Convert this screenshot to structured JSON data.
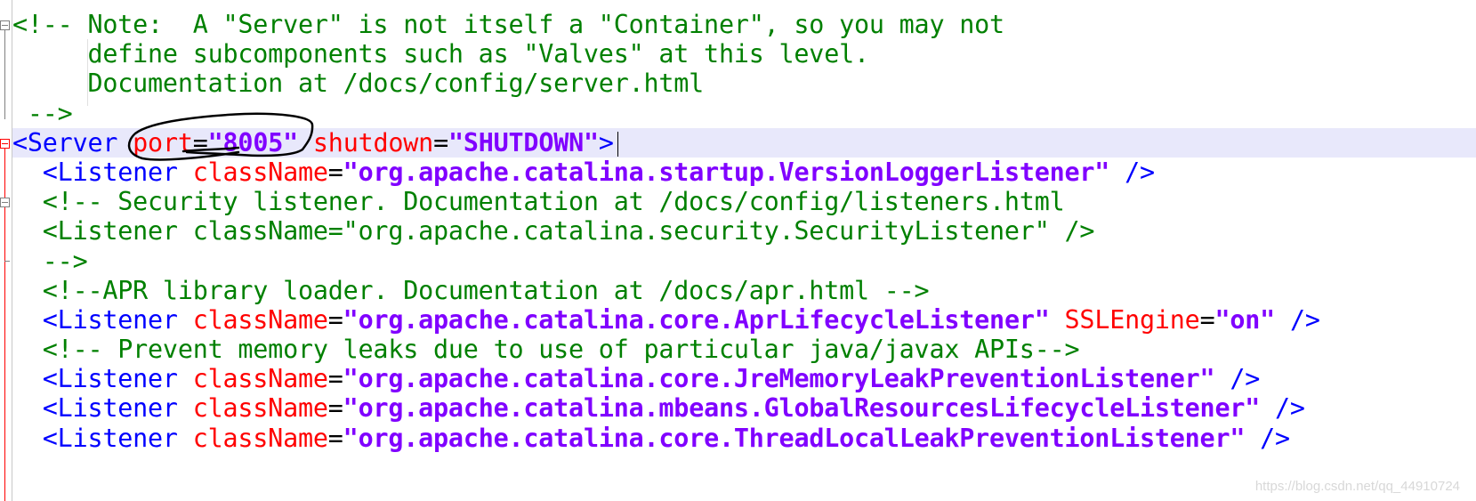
{
  "colors": {
    "comment": "#008000",
    "tag": "#0000ff",
    "attribute": "#ff0000",
    "value": "#8000ff",
    "current_line_bg": "#e8e8fb",
    "fold_marker": "#ff0000",
    "annotation_ink": "#000000"
  },
  "current_line": 4,
  "lines": [
    [
      [
        "comment",
        "<!-- Note:  A \"Server\" is not itself a \"Container\", so you may not"
      ]
    ],
    [
      [
        "comment",
        "     define subcomponents such as \"Valves\" at this level."
      ]
    ],
    [
      [
        "comment",
        "     Documentation at /docs/config/server.html"
      ]
    ],
    [
      [
        "comment",
        " -->"
      ]
    ],
    [
      [
        "tag",
        "<Server "
      ],
      [
        "attr",
        "port"
      ],
      [
        "eq",
        "="
      ],
      [
        "value",
        "\"8005\""
      ],
      [
        "text",
        " "
      ],
      [
        "attr",
        "shutdown"
      ],
      [
        "eq",
        "="
      ],
      [
        "value",
        "\"SHUTDOWN\""
      ],
      [
        "tag",
        ">"
      ]
    ],
    [
      [
        "tag",
        "  <Listener "
      ],
      [
        "attr",
        "className"
      ],
      [
        "eq",
        "="
      ],
      [
        "value",
        "\"org.apache.catalina.startup.VersionLoggerListener\""
      ],
      [
        "tag",
        " />"
      ]
    ],
    [
      [
        "comment",
        "  <!-- Security listener. Documentation at /docs/config/listeners.html"
      ]
    ],
    [
      [
        "comment",
        "  <Listener className=\"org.apache.catalina.security.SecurityListener\" />"
      ]
    ],
    [
      [
        "comment",
        "  -->"
      ]
    ],
    [
      [
        "comment",
        "  <!--APR library loader. Documentation at /docs/apr.html -->"
      ]
    ],
    [
      [
        "tag",
        "  <Listener "
      ],
      [
        "attr",
        "className"
      ],
      [
        "eq",
        "="
      ],
      [
        "value",
        "\"org.apache.catalina.core.AprLifecycleListener\""
      ],
      [
        "text",
        " "
      ],
      [
        "attr",
        "SSLEngine"
      ],
      [
        "eq",
        "="
      ],
      [
        "value",
        "\"on\""
      ],
      [
        "tag",
        " />"
      ]
    ],
    [
      [
        "comment",
        "  <!-- Prevent memory leaks due to use of particular java/javax APIs-->"
      ]
    ],
    [
      [
        "tag",
        "  <Listener "
      ],
      [
        "attr",
        "className"
      ],
      [
        "eq",
        "="
      ],
      [
        "value",
        "\"org.apache.catalina.core.JreMemoryLeakPreventionListener\""
      ],
      [
        "tag",
        " />"
      ]
    ],
    [
      [
        "tag",
        "  <Listener "
      ],
      [
        "attr",
        "className"
      ],
      [
        "eq",
        "="
      ],
      [
        "value",
        "\"org.apache.catalina.mbeans.GlobalResourcesLifecycleListener\""
      ],
      [
        "tag",
        " />"
      ]
    ],
    [
      [
        "tag",
        "  <Listener "
      ],
      [
        "attr",
        "className"
      ],
      [
        "eq",
        "="
      ],
      [
        "value",
        "\"org.apache.catalina.core.ThreadLocalLeakPreventionListener\""
      ],
      [
        "tag",
        " />"
      ]
    ]
  ],
  "watermark": "https://blog.csdn.net/qq_44910724"
}
